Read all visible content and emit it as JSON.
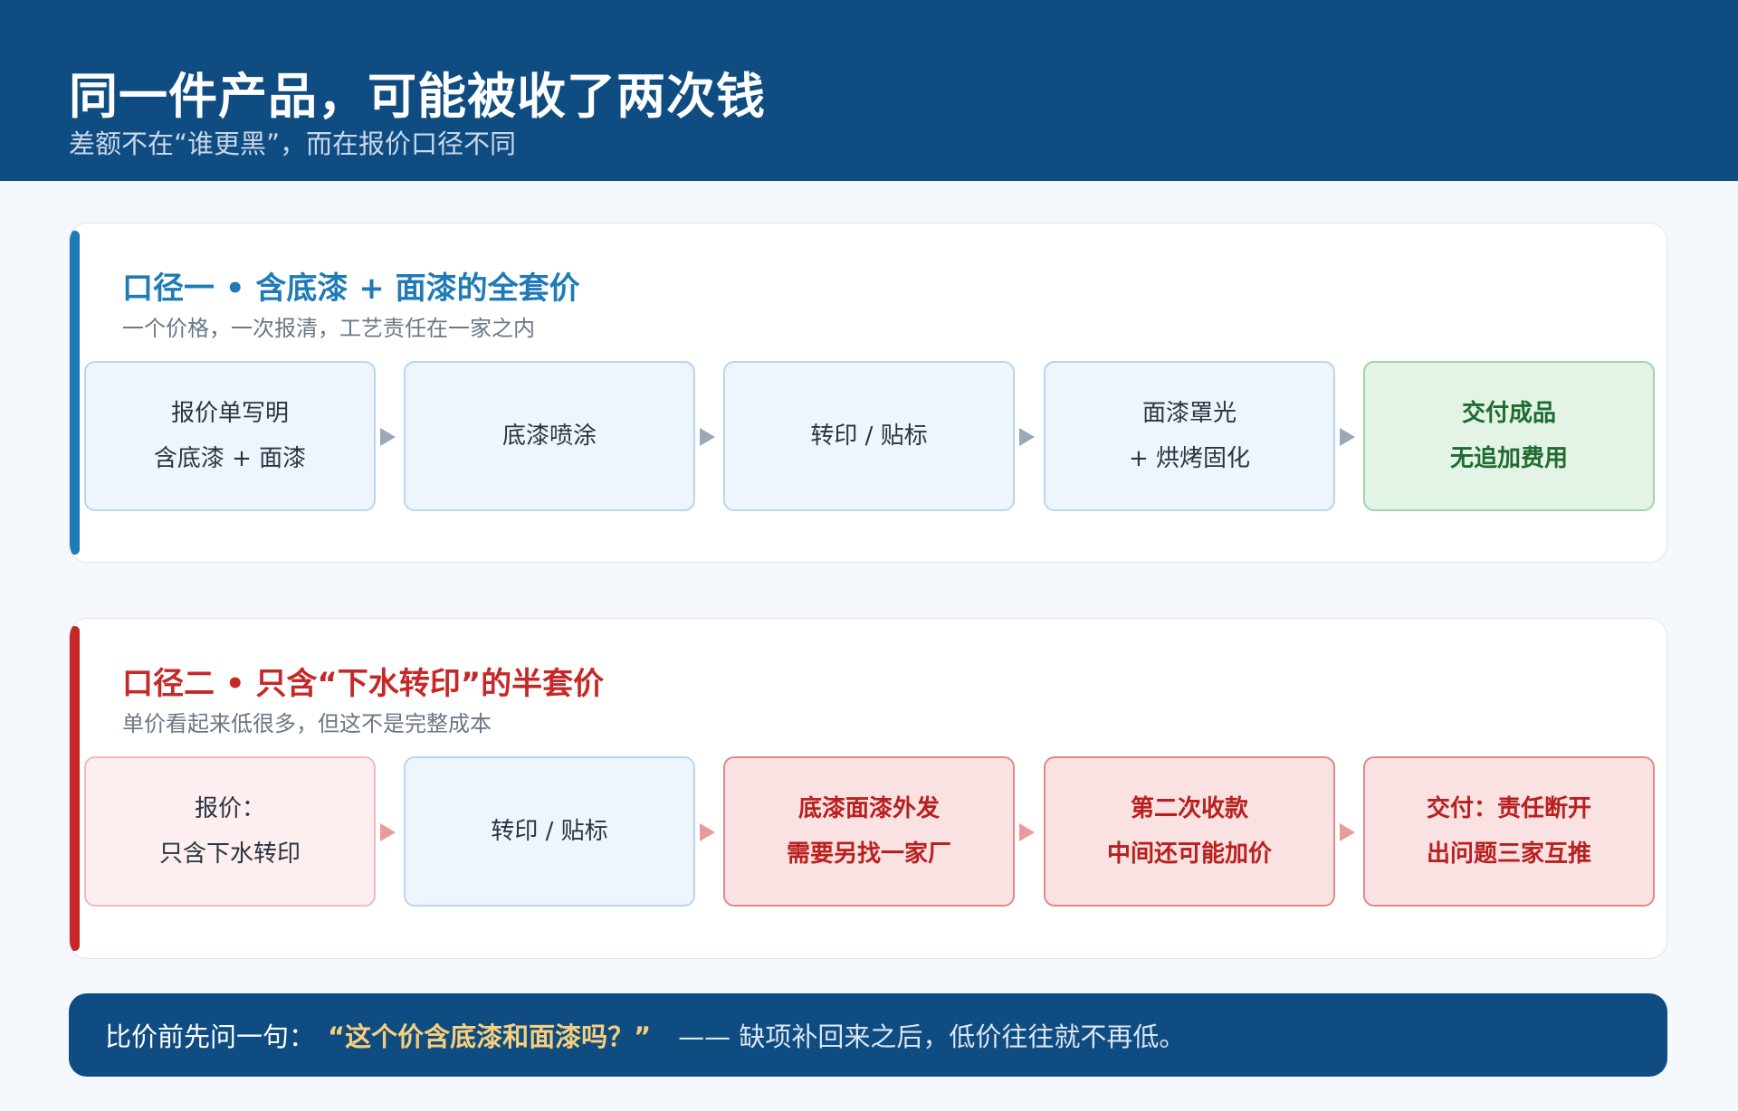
{
  "header": {
    "title": "同一件产品，可能被收了两次钱",
    "subtitle": "差额不在“谁更黑”，而在报价口径不同"
  },
  "panel_full": {
    "title": "口径一 • 含底漆 + 面漆的全套价",
    "subtitle": "一个价格，一次报清，工艺责任在一家之内",
    "steps": [
      {
        "lines": [
          "报价单写明",
          "含底漆 + 面漆"
        ]
      },
      {
        "lines": [
          "底漆喷涂"
        ]
      },
      {
        "lines": [
          "转印 / 贴标"
        ]
      },
      {
        "lines": [
          "面漆罩光",
          "+ 烘烤固化"
        ]
      },
      {
        "lines": [
          "交付成品",
          "无追加费用"
        ]
      }
    ]
  },
  "panel_half": {
    "title": "口径二 • 只含“下水转印”的半套价",
    "subtitle": "单价看起来低很多，但这不是完整成本",
    "steps": [
      {
        "lines": [
          "报价：",
          "只含下水转印"
        ]
      },
      {
        "lines": [
          "转印 / 贴标"
        ]
      },
      {
        "lines": [
          "底漆面漆外发",
          "需要另找一家厂"
        ]
      },
      {
        "lines": [
          "第二次收款",
          "中间还可能加价"
        ]
      },
      {
        "lines": [
          "交付：责任断开",
          "出问题三家互推"
        ]
      }
    ]
  },
  "footer": {
    "lead": "比价前先问一句：",
    "quote": "“这个价含底漆和面漆吗？”",
    "tail": "—— 缺项补回来之后，低价往往就不再低。"
  },
  "colors": {
    "header_bg": "#0f4c81",
    "accent_blue": "#1f7ab8",
    "accent_red": "#c62828",
    "success_green": "#1f6b30",
    "quote_gold": "#f7cf7d"
  }
}
